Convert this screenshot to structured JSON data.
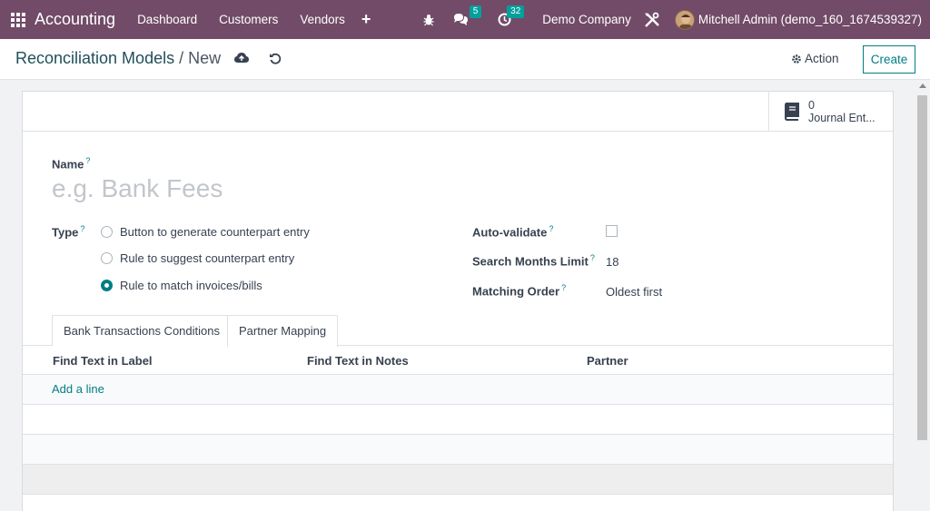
{
  "navbar": {
    "app_name": "Accounting",
    "menu": [
      "Dashboard",
      "Customers",
      "Vendors"
    ],
    "plus": "+",
    "chat_count": "5",
    "activity_count": "32",
    "company": "Demo Company",
    "user": "Mitchell Admin (demo_160_1674539327)",
    "bg_color": "#714b67"
  },
  "control": {
    "breadcrumb_parent": "Reconciliation Models",
    "breadcrumb_sep": "/",
    "breadcrumb_current": "New",
    "action_label": "Action",
    "create_label": "Create"
  },
  "smart_button": {
    "count": "0",
    "label": "Journal Ent..."
  },
  "form": {
    "name_label": "Name",
    "name_placeholder": "e.g. Bank Fees",
    "help_mark": "?",
    "type_label": "Type",
    "type_options": [
      {
        "label": "Button to generate counterpart entry",
        "checked": false
      },
      {
        "label": "Rule to suggest counterpart entry",
        "checked": false
      },
      {
        "label": "Rule to match invoices/bills",
        "checked": true
      }
    ],
    "auto_validate_label": "Auto-validate",
    "auto_validate_checked": false,
    "search_months_label": "Search Months Limit",
    "search_months_value": "18",
    "matching_order_label": "Matching Order",
    "matching_order_value": "Oldest first"
  },
  "tabs": [
    {
      "label": "Bank Transactions Conditions",
      "active": false
    },
    {
      "label": "Partner Mapping",
      "active": true
    }
  ],
  "table": {
    "columns": [
      "Find Text in Label",
      "Find Text in Notes",
      "Partner"
    ],
    "add_line": "Add a line"
  },
  "colors": {
    "accent": "#017e84",
    "primary": "#714b67"
  }
}
